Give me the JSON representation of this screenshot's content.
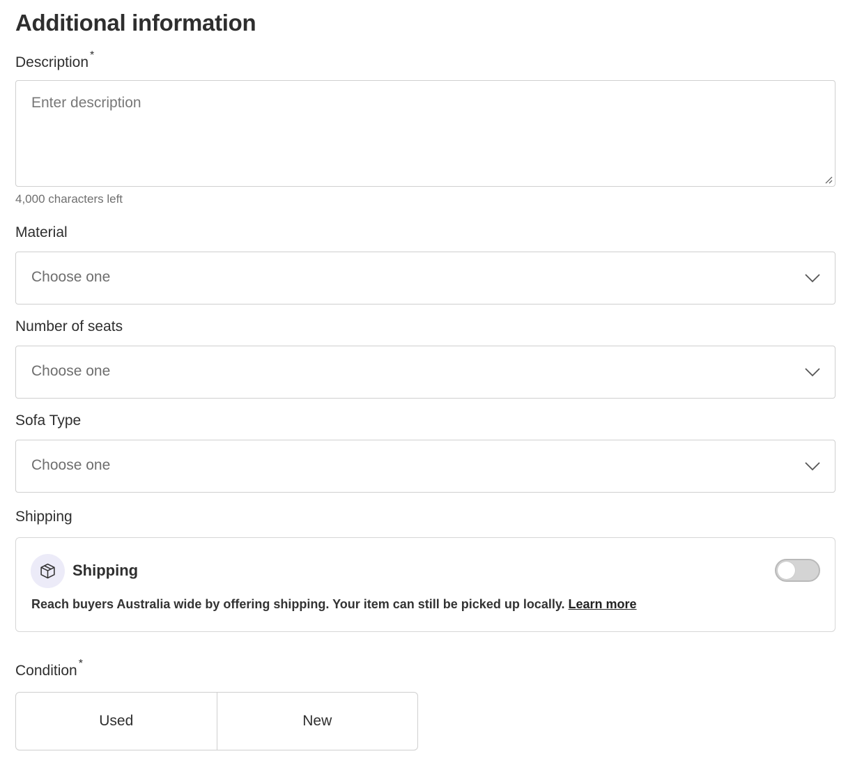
{
  "page": {
    "title": "Additional information"
  },
  "description": {
    "label": "Description",
    "required_mark": "*",
    "placeholder": "Enter description",
    "value": "",
    "chars_left": "4,000 characters left"
  },
  "material": {
    "label": "Material",
    "selected": "Choose one"
  },
  "seats": {
    "label": "Number of seats",
    "selected": "Choose one"
  },
  "sofa_type": {
    "label": "Sofa Type",
    "selected": "Choose one"
  },
  "shipping": {
    "section_label": "Shipping",
    "card_title": "Shipping",
    "icon": "package-icon",
    "enabled": false,
    "description": "Reach buyers Australia wide by offering shipping. Your item can still be picked up locally.",
    "learn_more": "Learn more"
  },
  "condition": {
    "label": "Condition",
    "required_mark": "*",
    "options": [
      "Used",
      "New"
    ]
  }
}
